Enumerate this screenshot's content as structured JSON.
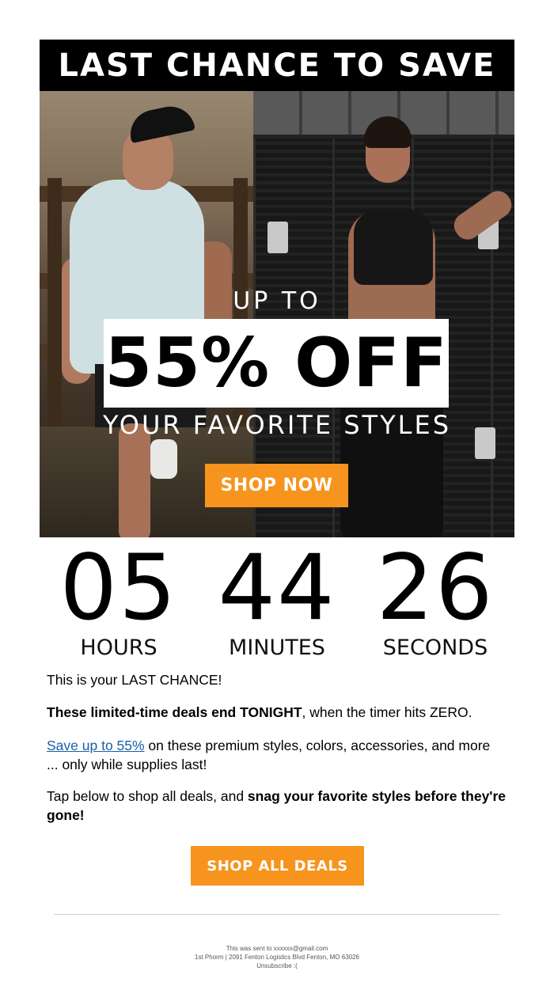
{
  "header": {
    "title": "LAST CHANCE TO SAVE"
  },
  "hero": {
    "upto": "UP TO",
    "headline": "55% OFF",
    "subhead": "YOUR FAVORITE STYLES",
    "cta_label": "SHOP NOW"
  },
  "timer": {
    "hours_value": "05",
    "hours_label": "HOURS",
    "minutes_value": "44",
    "minutes_label": "MINUTES",
    "seconds_value": "26",
    "seconds_label": "SECONDS"
  },
  "body": {
    "p1": "This is your LAST CHANCE!",
    "p2_bold": "These limited-time deals end TONIGHT",
    "p2_rest": ", when the timer hits ZERO.",
    "p3_link": "Save up to 55%",
    "p3_line1_rest": " on these premium styles, colors, accessories, and more",
    "p3_line2": "... only while supplies last!",
    "p4_start": "Tap below to shop all deals, and ",
    "p4_bold": "snag your favorite styles before they're gone!"
  },
  "cta_bottom": {
    "label": "SHOP ALL DEALS"
  },
  "footer": {
    "sent_to": "This was sent to xxxxxx@gmail.com",
    "address": "1st Phorm | 2091 Fenton Logistics Blvd Fenton, MO 63026",
    "unsubscribe": "Unsubscribe :("
  },
  "colors": {
    "accent": "#f7941d",
    "link": "#1a5fa6",
    "header_bg": "#000000"
  }
}
